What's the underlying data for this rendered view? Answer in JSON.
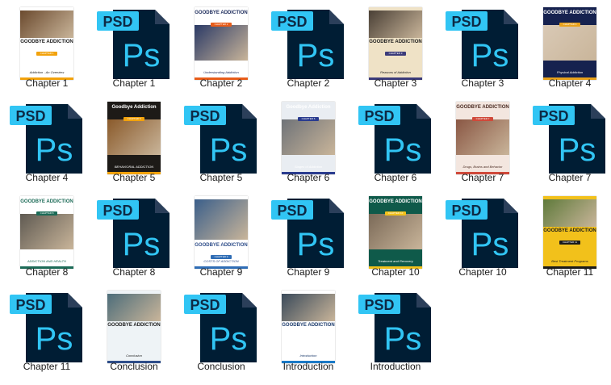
{
  "grid": {
    "items": [
      {
        "label": "Chapter 1",
        "kind": "cover",
        "style": "c1"
      },
      {
        "label": "Chapter 1",
        "kind": "psd"
      },
      {
        "label": "Chapter 2",
        "kind": "cover",
        "style": "c2"
      },
      {
        "label": "Chapter 2",
        "kind": "psd"
      },
      {
        "label": "Chapter 3",
        "kind": "cover",
        "style": "c3"
      },
      {
        "label": "Chapter 3",
        "kind": "psd"
      },
      {
        "label": "Chapter 4",
        "kind": "cover",
        "style": "c4"
      },
      {
        "label": "Chapter 4",
        "kind": "psd"
      },
      {
        "label": "Chapter 5",
        "kind": "cover",
        "style": "c5"
      },
      {
        "label": "Chapter 5",
        "kind": "psd"
      },
      {
        "label": "Chapter 6",
        "kind": "cover",
        "style": "c6"
      },
      {
        "label": "Chapter 6",
        "kind": "psd"
      },
      {
        "label": "Chapter 7",
        "kind": "cover",
        "style": "c7"
      },
      {
        "label": "Chapter 7",
        "kind": "psd"
      },
      {
        "label": "Chapter 8",
        "kind": "cover",
        "style": "c8"
      },
      {
        "label": "Chapter 8",
        "kind": "psd"
      },
      {
        "label": "Chapter 9",
        "kind": "cover",
        "style": "c9"
      },
      {
        "label": "Chapter 9",
        "kind": "psd"
      },
      {
        "label": "Chapter 10",
        "kind": "cover",
        "style": "c10"
      },
      {
        "label": "Chapter 10",
        "kind": "psd"
      },
      {
        "label": "Chapter 11",
        "kind": "cover",
        "style": "c11"
      },
      {
        "label": "Chapter 11",
        "kind": "psd"
      },
      {
        "label": "Conclusion",
        "kind": "cover",
        "style": "cc"
      },
      {
        "label": "Conclusion",
        "kind": "psd"
      },
      {
        "label": "Introduction",
        "kind": "cover",
        "style": "ci"
      },
      {
        "label": "Introduction",
        "kind": "psd"
      }
    ]
  },
  "psd_icon": {
    "badge_text": "PSD",
    "app_text": "Ps",
    "badge_color": "#31c5f4",
    "body_color": "#001d34",
    "fold_color": "#2b3f5a",
    "text_color": "#31c5f4"
  },
  "covers": {
    "c1": {
      "title": "GOODBYE ADDICTION",
      "subtitle": "Addiction - An Overview",
      "tag": "CHAPTER 1",
      "bg": "#ffffff",
      "photo": "#6b4a2e",
      "accent": "#f2a20c",
      "text": "#1b1b1b",
      "title_pos": "mid"
    },
    "c2": {
      "title": "GOODBYE ADDICTION",
      "subtitle": "Understanding Addiction",
      "tag": "CHAPTER 2",
      "bg": "#ffffff",
      "photo": "#2b3a66",
      "accent": "#e85d1a",
      "text": "#1b2a5a",
      "title_pos": "top"
    },
    "c3": {
      "title": "GOODBYE ADDICTION",
      "subtitle": "Reasons of Addiction",
      "tag": "CHAPTER 3",
      "bg": "#efe2c6",
      "photo": "#4a4036",
      "accent": "#3b3b7a",
      "text": "#1b1b1b",
      "title_pos": "mid"
    },
    "c4": {
      "title": "GOODBYE ADDICTION",
      "subtitle": "Physical Addiction",
      "tag": "CHAPTER 4",
      "bg": "#16224f",
      "photo": "#d9c9b5",
      "accent": "#e8a11b",
      "text": "#ffffff",
      "title_pos": "top"
    },
    "c5": {
      "title": "Goodbye Addiction",
      "subtitle": "BEHAVIORAL ADDICTION",
      "tag": "CHAPTER 5",
      "bg": "#1d1a17",
      "photo": "#8a5a2b",
      "accent": "#f2a20c",
      "text": "#ffffff",
      "title_pos": "top"
    },
    "c6": {
      "title": "Goodbye Addiction",
      "subtitle": "Stages of Addiction",
      "tag": "CHAPTER 6",
      "bg": "#e9edf2",
      "photo": "#6f7378",
      "accent": "#2a3c8f",
      "text": "#ffffff",
      "title_pos": "top"
    },
    "c7": {
      "title": "GOODBYE ADDICTION",
      "subtitle": "Drugs, Brains and Behavior",
      "tag": "CHAPTER 7",
      "bg": "#f3e6df",
      "photo": "#8a5744",
      "accent": "#d0493a",
      "text": "#4a2b22",
      "title_pos": "top"
    },
    "c8": {
      "title": "GOODBYE ADDICTION",
      "subtitle": "ADDICTION AND HEALTH",
      "tag": "CHAPTER 8",
      "bg": "#ffffff",
      "photo": "#5f5a52",
      "accent": "#1c6b57",
      "text": "#1c6b57",
      "title_pos": "top"
    },
    "c9": {
      "title": "GOODBYE ADDICTION",
      "subtitle": "COSTS OF ADDICTION",
      "tag": "CHAPTER 9",
      "bg": "#ffffff",
      "photo": "#3b5f8a",
      "accent": "#2f6db5",
      "text": "#2f4e8a",
      "title_pos": "bottom"
    },
    "c10": {
      "title": "GOODBYE ADDICTION",
      "subtitle": "Treatment and Recovery",
      "tag": "CHAPTER 10",
      "bg": "#0f5a4a",
      "photo": "#7b6a58",
      "accent": "#f2c11b",
      "text": "#ffffff",
      "title_pos": "top"
    },
    "c11": {
      "title": "GOODBYE ADDICTION",
      "subtitle": "Best Treatment Programs",
      "tag": "CHAPTER 11",
      "bg": "#f2c11b",
      "photo": "#5f7a3b",
      "accent": "#1b1b1b",
      "text": "#1b1b1b",
      "title_pos": "mid"
    },
    "cc": {
      "title": "GOODBYE ADDICTION",
      "subtitle": "Conclusion",
      "tag": "",
      "bg": "#eef3f6",
      "photo": "#4d6d7a",
      "accent": "#2f4e8a",
      "text": "#1b1b1b",
      "title_pos": "mid"
    },
    "ci": {
      "title": "GOODBYE ADDICTION",
      "subtitle": "Introduction",
      "tag": "",
      "bg": "#ffffff",
      "photo": "#3a4a5a",
      "accent": "#1b7ac7",
      "text": "#1b3a6b",
      "title_pos": "mid"
    }
  }
}
